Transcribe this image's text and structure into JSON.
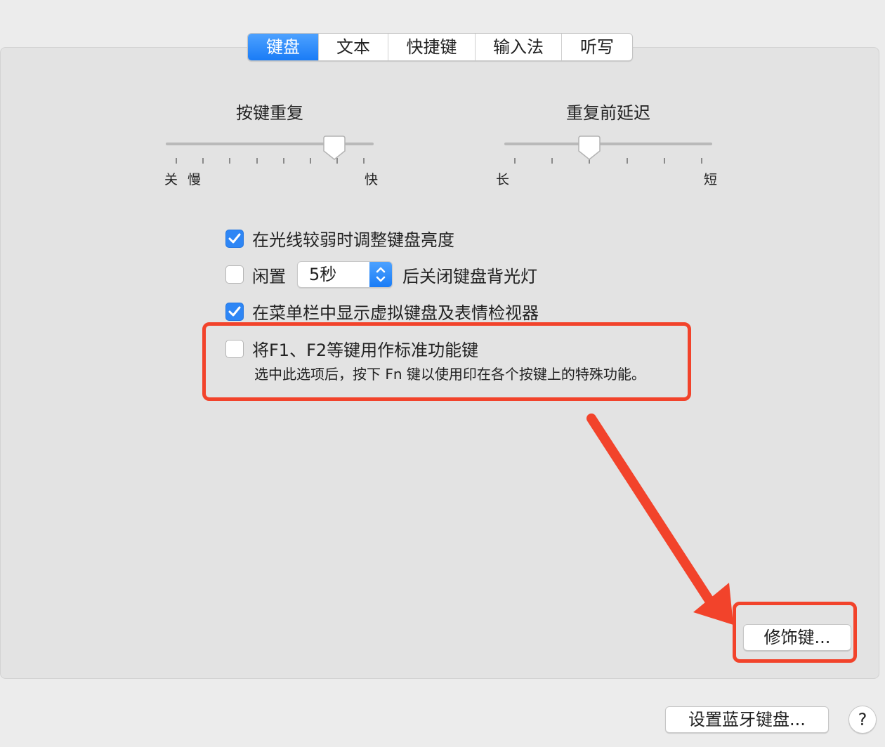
{
  "tabs": [
    {
      "label": "键盘",
      "active": true
    },
    {
      "label": "文本",
      "active": false
    },
    {
      "label": "快捷键",
      "active": false
    },
    {
      "label": "输入法",
      "active": false
    },
    {
      "label": "听写",
      "active": false
    }
  ],
  "key_repeat": {
    "title": "按键重复",
    "label_off": "关",
    "label_slow": "慢",
    "label_fast": "快",
    "level": 0.84
  },
  "delay_until_repeat": {
    "title": "重复前延迟",
    "label_long": "长",
    "label_short": "短",
    "level": 0.4
  },
  "options": {
    "adjust_brightness": {
      "label": "在光线较弱时调整键盘亮度",
      "checked": true
    },
    "backlight_idle": {
      "prefix": "闲置",
      "value": "5秒",
      "suffix": "后关闭键盘背光灯",
      "checked": false
    },
    "show_viewer": {
      "label": "在菜单栏中显示虚拟键盘及表情检视器",
      "checked": true
    },
    "fn_keys": {
      "label": "将F1、F2等键用作标准功能键",
      "description": "选中此选项后，按下 Fn 键以使用印在各个按键上的特殊功能。",
      "checked": false
    }
  },
  "buttons": {
    "modifier_keys": "修饰键...",
    "bluetooth_setup": "设置蓝牙键盘...",
    "help": "?"
  },
  "colors": {
    "accent": "#1a7cf6",
    "callout": "#f2432b"
  }
}
